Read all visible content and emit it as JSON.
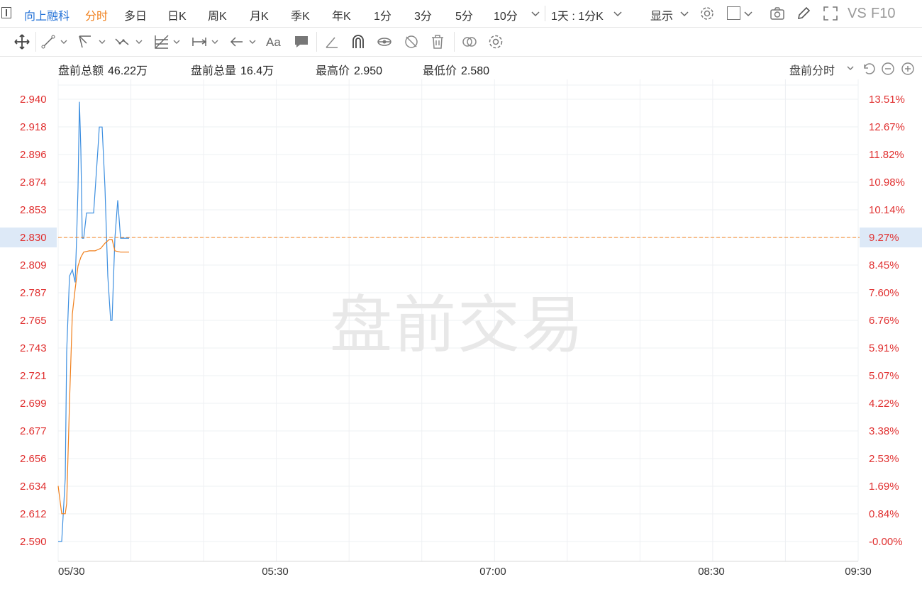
{
  "topbar": {
    "stock_name": "向上融科",
    "timeframes": [
      "分时",
      "多日",
      "日K",
      "周K",
      "月K",
      "季K",
      "年K",
      "1分",
      "3分",
      "5分",
      "10分"
    ],
    "active_timeframe": "分时",
    "range_select": "1天 : 1分K",
    "display_label": "显示",
    "vs_label": "VS",
    "f10_label": "F10"
  },
  "stats": {
    "premarket_amount_label": "盘前总额",
    "premarket_amount_value": "46.22万",
    "premarket_volume_label": "盘前总量",
    "premarket_volume_value": "16.4万",
    "high_label": "最高价",
    "high_value": "2.950",
    "low_label": "最低价",
    "low_value": "2.580",
    "mode_label": "盘前分时"
  },
  "colors": {
    "price_line": "#3d8fe0",
    "avg_line": "#f07f1b",
    "axis_red": "#e03030",
    "active_tab": "#f07f1b",
    "stock_name": "#1f6fd6"
  },
  "chart_data": {
    "type": "line",
    "watermark": "盘前交易",
    "current_price_label": "2.830",
    "current_pct_label": "9.27%",
    "y_ticks": [
      "2.940",
      "2.918",
      "2.896",
      "2.874",
      "2.853",
      "2.830",
      "2.809",
      "2.787",
      "2.765",
      "2.743",
      "2.721",
      "2.699",
      "2.677",
      "2.656",
      "2.634",
      "2.612",
      "2.590"
    ],
    "y_pct_ticks": [
      "13.51%",
      "12.67%",
      "11.82%",
      "10.98%",
      "10.14%",
      "9.27%",
      "8.45%",
      "7.60%",
      "6.76%",
      "5.91%",
      "5.07%",
      "4.22%",
      "3.38%",
      "2.53%",
      "1.69%",
      "0.84%",
      "-0.00%"
    ],
    "x_ticks": [
      "05/30",
      "05:30",
      "07:00",
      "08:30",
      "09:30"
    ],
    "ylim": [
      2.59,
      2.94
    ],
    "grid": true,
    "series": [
      {
        "role": "price",
        "x": [
          0,
          2.5,
          5,
          6,
          8,
          10,
          12,
          13,
          14,
          15,
          16,
          17,
          18,
          20,
          22,
          25,
          28,
          29,
          31,
          33,
          35,
          37,
          38,
          40,
          42,
          44,
          45,
          47,
          49,
          50
        ],
        "values": [
          2.59,
          2.59,
          2.64,
          2.74,
          2.8,
          2.805,
          2.795,
          2.83,
          2.87,
          2.938,
          2.9,
          2.83,
          2.83,
          2.85,
          2.85,
          2.85,
          2.9,
          2.918,
          2.918,
          2.87,
          2.8,
          2.765,
          2.765,
          2.83,
          2.86,
          2.83,
          2.83,
          2.83,
          2.83,
          2.83
        ]
      },
      {
        "role": "average",
        "x": [
          0,
          2.5,
          5,
          6,
          8,
          10,
          12,
          14,
          16,
          18,
          22,
          26,
          30,
          33,
          36,
          38,
          40,
          44,
          47,
          50
        ],
        "values": [
          2.634,
          2.612,
          2.612,
          2.62,
          2.7,
          2.77,
          2.79,
          2.808,
          2.815,
          2.819,
          2.82,
          2.82,
          2.822,
          2.826,
          2.829,
          2.829,
          2.82,
          2.819,
          2.819,
          2.819
        ]
      }
    ]
  }
}
